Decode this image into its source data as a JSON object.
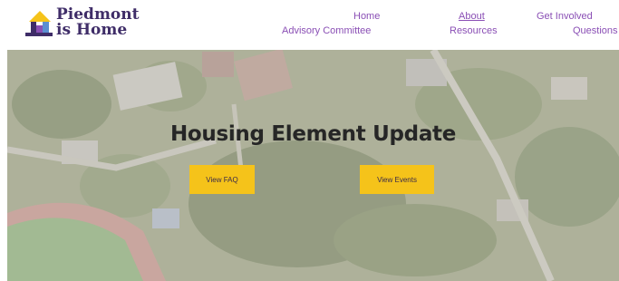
{
  "brand": {
    "name_line1": "Piedmont",
    "name_line2": "is Home"
  },
  "nav": {
    "home": "Home",
    "about": "About",
    "get_involved": "Get Involved",
    "advisory_committee": "Advisory Committee",
    "resources": "Resources",
    "questions": "Questions"
  },
  "hero": {
    "title": "Housing Element Update",
    "faq_button": "View FAQ",
    "events_button": "View Events"
  },
  "colors": {
    "brand_purple": "#3f2d68",
    "nav_purple": "#8a4fb5",
    "cta_yellow": "#f5c31a"
  }
}
